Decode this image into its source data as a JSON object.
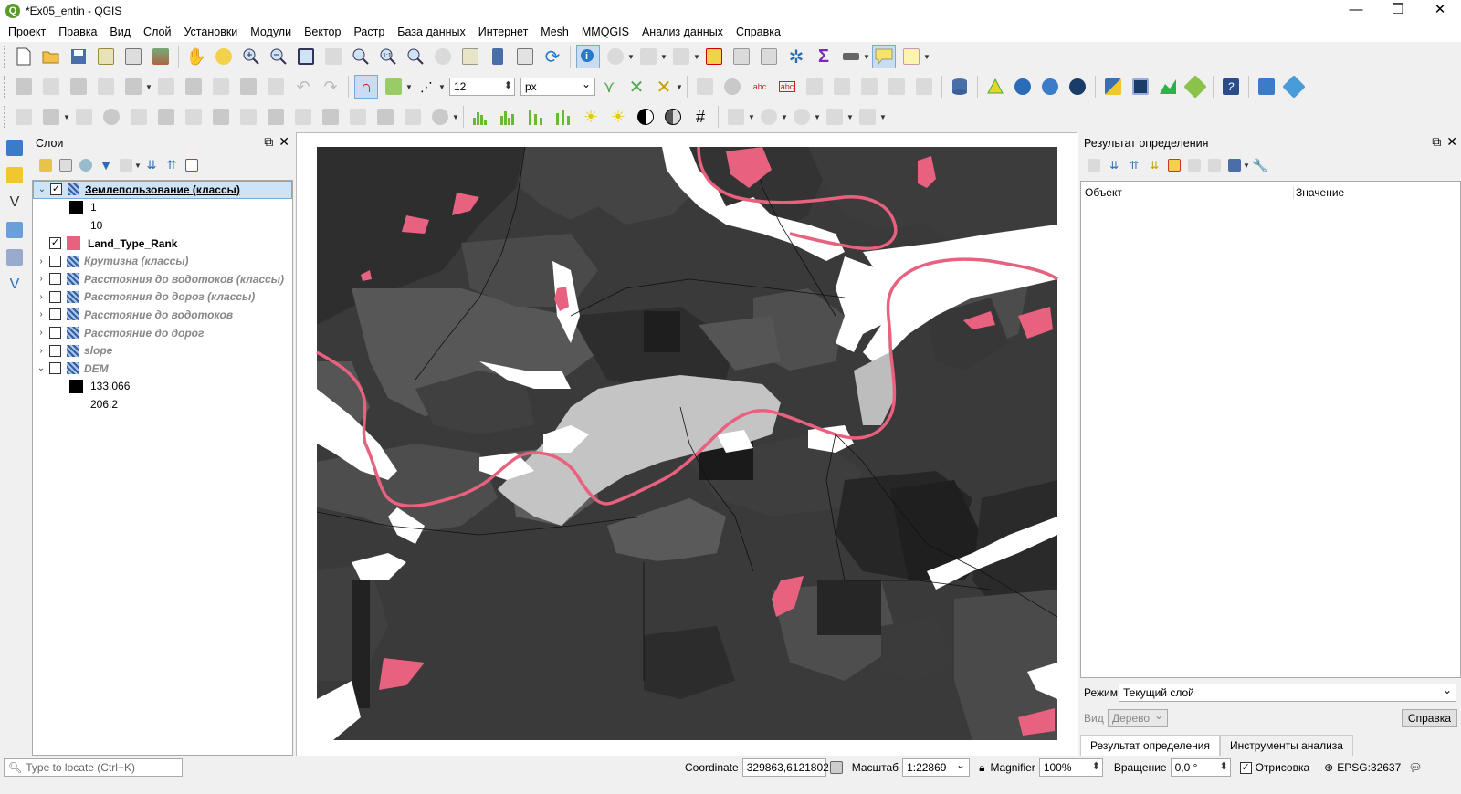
{
  "window": {
    "title": "*Ex05_entin - QGIS",
    "logo": "Q",
    "minimize": "—",
    "restore": "❐",
    "close": "✕"
  },
  "menu": [
    "Проект",
    "Правка",
    "Вид",
    "Слой",
    "Установки",
    "Модули",
    "Вектор",
    "Растр",
    "База данных",
    "Интернет",
    "Mesh",
    "MMQGIS",
    "Анализ данных",
    "Справка"
  ],
  "toolbar": {
    "snap_tolerance": "12",
    "snap_units": "px"
  },
  "layers_panel": {
    "title": "Слои",
    "items": [
      {
        "name": "Землепользование (классы)",
        "checked": true,
        "style": "bold-sel",
        "type": "raster",
        "expanded": true,
        "legend": [
          {
            "label": "1",
            "color": "#000000"
          },
          {
            "label": "10",
            "color": "#ffffff"
          }
        ]
      },
      {
        "name": "Land_Type_Rank",
        "checked": true,
        "style": "bold",
        "type": "fill",
        "swatch": "#e8617f"
      },
      {
        "name": "Крутизна (классы)",
        "checked": false,
        "style": "ital",
        "type": "raster"
      },
      {
        "name": "Расстояния до водотоков (классы)",
        "checked": false,
        "style": "ital",
        "type": "raster"
      },
      {
        "name": "Расстояния до дорог (классы)",
        "checked": false,
        "style": "ital",
        "type": "raster"
      },
      {
        "name": "Расстояние до водотоков",
        "checked": false,
        "style": "ital",
        "type": "raster"
      },
      {
        "name": "Расстояние до дорог",
        "checked": false,
        "style": "ital",
        "type": "raster"
      },
      {
        "name": "slope",
        "checked": false,
        "style": "ital",
        "type": "raster"
      },
      {
        "name": "DEM",
        "checked": false,
        "style": "ital",
        "type": "raster",
        "expanded": true,
        "legend": [
          {
            "label": "133.066",
            "color": "#000000"
          },
          {
            "label": "206.2",
            "color": "#ffffff"
          }
        ]
      }
    ]
  },
  "identify_panel": {
    "title": "Результат определения",
    "col_object": "Объект",
    "col_value": "Значение",
    "mode_label": "Режим",
    "mode_value": "Текущий слой",
    "view_label": "Вид",
    "view_value": "Дерево",
    "help_button": "Справка",
    "tabs": [
      "Результат определения",
      "Инструменты анализа"
    ]
  },
  "statusbar": {
    "locate_placeholder": "Type to locate (Ctrl+K)",
    "coordinate_label": "Coordinate",
    "coordinate_value": "329863,6121802",
    "scale_label": "Масштаб",
    "scale_value": "1:22869",
    "magnifier_label": "Magnifier",
    "magnifier_value": "100%",
    "rotation_label": "Вращение",
    "rotation_value": "0,0 °",
    "render_label": "Отрисовка",
    "render_checked": true,
    "crs_value": "EPSG:32637"
  },
  "colors": {
    "accent_pink": "#e8617f",
    "map_dark": "#3a3a3a",
    "map_mid": "#555555",
    "map_light": "#c4c4c4",
    "selection": "#cde4f7"
  }
}
